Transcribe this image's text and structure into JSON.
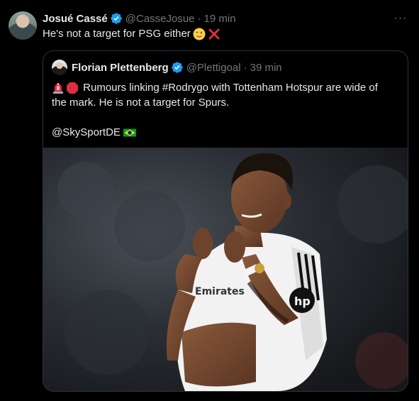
{
  "tweet": {
    "author_name": "Josué Cassé",
    "author_handle": "@CasseJosue",
    "separator": "·",
    "time": "19 min",
    "text": "He's not a target for PSG either",
    "text_emojis": [
      "winking-face-emoji",
      "cross-mark-emoji"
    ],
    "more_label": "···"
  },
  "quote": {
    "author_name": "Florian Plettenberg",
    "author_handle": "@Plettigoal",
    "separator": "·",
    "time": "39 min",
    "line1": "Rumours linking #Rodrygo with Tottenham Hotspur are wide of",
    "line2": "the mark. He is not a target for Spurs.",
    "line3": "@SkySportDE",
    "line1_emojis": [
      "siren-emoji",
      "stop-sign-emoji"
    ],
    "line3_emojis": [
      "brazil-flag-emoji"
    ],
    "photo_shirt_text": "Emirates",
    "photo_sponsor_text": "hp"
  },
  "colors": {
    "background": "#000000",
    "text": "#e7e9ea",
    "muted": "#71767b",
    "verified": "#1d9bf0",
    "border": "#2f3336"
  }
}
